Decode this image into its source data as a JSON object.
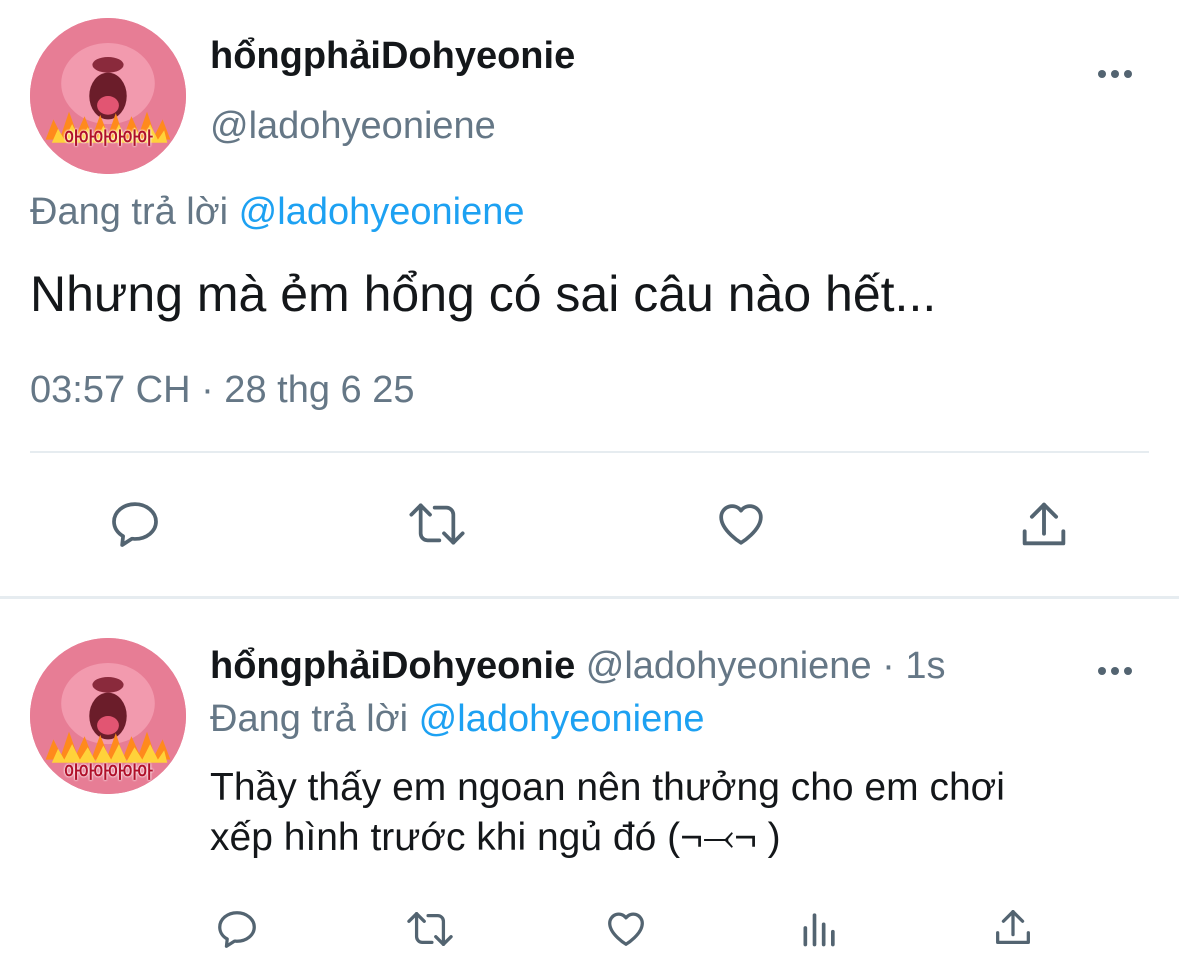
{
  "main_tweet": {
    "display_name": "hổngphảiDohyeonie",
    "handle": "@ladohyeoniene",
    "replying_prefix": "Đang trả lời",
    "replying_to": "@ladohyeoniene",
    "text": "Nhưng mà ẻm hổng có sai câu nào hết...",
    "timestamp": "03:57 CH · 28 thg 6 25",
    "avatar_caption": "아아아아아아",
    "actions": [
      "reply-icon",
      "retweet-icon",
      "like-icon",
      "share-icon"
    ]
  },
  "reply_tweet": {
    "display_name": "hổngphảiDohyeonie",
    "handle": "@ladohyeoniene",
    "time_ago": "· 1s",
    "replying_prefix": "Đang trả lời",
    "replying_to": "@ladohyeoniene",
    "text_line1": "Thầy thấy em ngoan nên thưởng cho em chơi",
    "text_line2": "xếp hình trước khi ngủ đó (¬⤙¬ )",
    "avatar_caption": "아아아아아아",
    "actions": [
      "reply-icon",
      "retweet-icon",
      "like-icon",
      "analytics-icon",
      "share-icon"
    ]
  },
  "colors": {
    "link": "#1da1f2",
    "muted": "#657786",
    "icon": "#536471",
    "divider": "#e6ecf0"
  }
}
